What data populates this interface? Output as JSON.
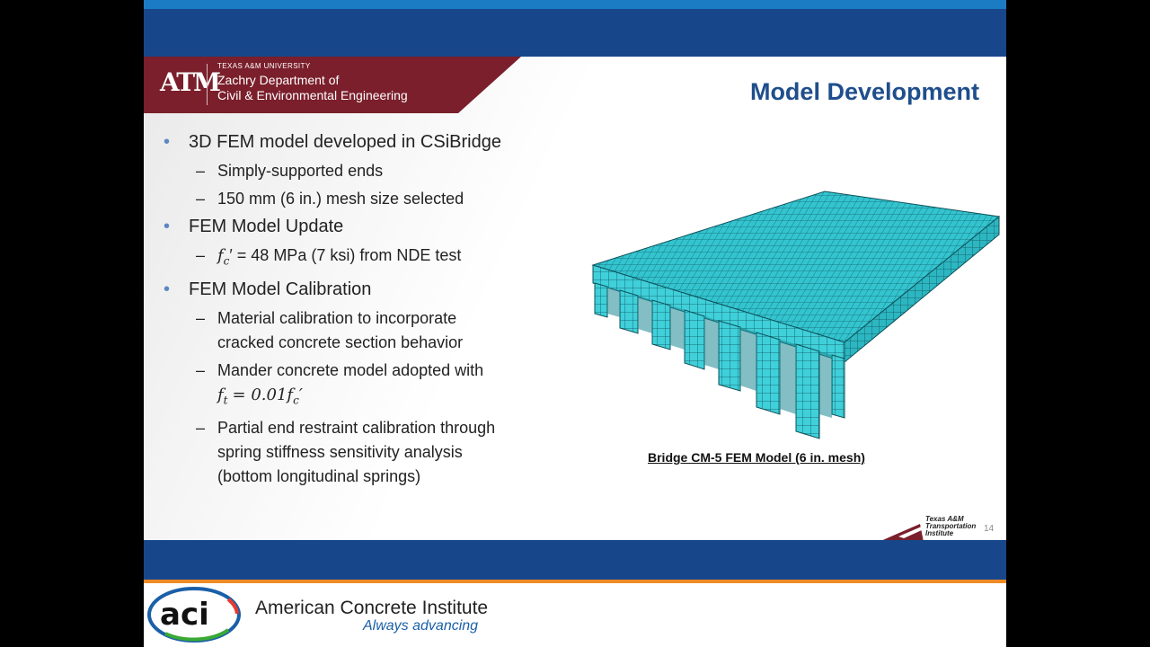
{
  "header": {
    "university": "TEXAS A&M UNIVERSITY",
    "department_line1": "Zachry Department of",
    "department_line2": "Civil & Environmental Engineering",
    "logo": "ATM"
  },
  "slide": {
    "title": "Model Development",
    "bullets": [
      {
        "text": "3D FEM model developed in CSiBridge",
        "sub": [
          "Simply-supported ends",
          "150 mm (6 in.) mesh size selected"
        ]
      },
      {
        "text": "FEM Model Update",
        "sub_math_prefix": "f",
        "sub_math_sub": "c",
        "sub_math_eq": "′ = 48 MPa (7 ksi) from NDE test"
      },
      {
        "text": "FEM Model Calibration",
        "sub": [
          "Material calibration to incorporate",
          "cracked concrete section behavior",
          "Mander concrete model adopted with",
          "f",
          "t",
          "= 0.01",
          "f",
          "c",
          "′",
          "Partial end restraint calibration through",
          "spring stiffness sensitivity analysis",
          "(bottom longitudinal springs)"
        ]
      }
    ],
    "figure_caption": "Bridge CM-5 FEM Model (6 in. mesh)",
    "page_number": "14",
    "tti_lines": [
      "Texas A&M",
      "Transportation",
      "Institute"
    ]
  },
  "footer": {
    "org_name": "American Concrete Institute",
    "tagline": "Always advancing",
    "logo_text": "aci"
  },
  "colors": {
    "band_blue": "#17478a",
    "stripe_blue": "#1b7cc4",
    "maroon": "#7a1f2b",
    "mesh_cyan": "#2fc2cc",
    "orange": "#f08a24"
  }
}
